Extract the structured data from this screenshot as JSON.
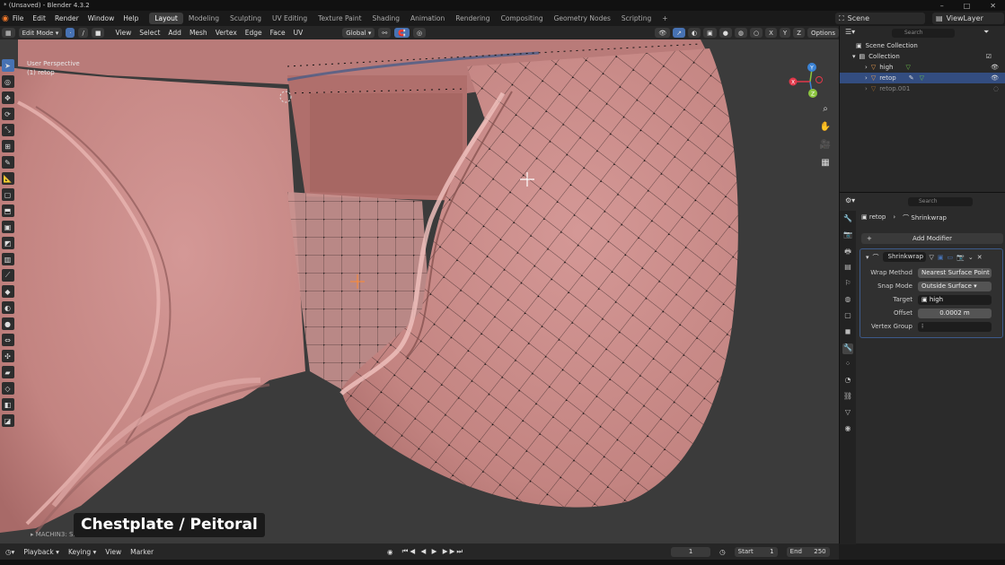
{
  "window": {
    "title": "* (Unsaved) - Blender 4.3.2",
    "controls": [
      "–",
      "□",
      "✕"
    ]
  },
  "menu": [
    "File",
    "Edit",
    "Render",
    "Window",
    "Help"
  ],
  "workspaces": [
    "Layout",
    "Modeling",
    "Sculpting",
    "UV Editing",
    "Texture Paint",
    "Shading",
    "Animation",
    "Rendering",
    "Compositing",
    "Geometry Nodes",
    "Scripting",
    "+"
  ],
  "scene": "Scene",
  "view_layer": "ViewLayer",
  "viewport_header": {
    "mode": "Edit Mode",
    "menus": [
      "View",
      "Select",
      "Add",
      "Mesh",
      "Vertex",
      "Edge",
      "Face",
      "UV"
    ],
    "orientation": "Global",
    "axes": [
      "X",
      "Y",
      "Z"
    ],
    "options": "Options"
  },
  "viewport": {
    "perspective": "User Perspective",
    "object": "(1) retop"
  },
  "gizmo": {
    "x": "X",
    "y": "Y",
    "z": "Z"
  },
  "caption": "Chestplate / Peitoral",
  "operator": "MACHIN3: Smart Vert",
  "timeline": {
    "menus": [
      "Playback",
      "Keying",
      "View",
      "Marker"
    ],
    "current_frame": "1",
    "start_label": "Start",
    "start": "1",
    "end_label": "End",
    "end": "250"
  },
  "outliner": {
    "search_placeholder": "Search",
    "root": "Scene Collection",
    "collection": "Collection",
    "objects": [
      {
        "name": "high",
        "selected": false
      },
      {
        "name": "retop",
        "selected": true
      },
      {
        "name": "retop.001",
        "selected": false
      }
    ]
  },
  "properties": {
    "search_placeholder": "Search",
    "breadcrumb": {
      "object": "retop",
      "modifier": "Shrinkwrap"
    },
    "add_modifier": "Add Modifier",
    "modifier": {
      "name": "Shrinkwrap",
      "wrap_method_label": "Wrap Method",
      "wrap_method": "Nearest Surface Point",
      "snap_mode_label": "Snap Mode",
      "snap_mode": "Outside Surface",
      "target_label": "Target",
      "target": "high",
      "offset_label": "Offset",
      "offset": "0.0002 m",
      "vertex_group_label": "Vertex Group",
      "vertex_group": ""
    }
  },
  "colors": {
    "accent": "#4772b3",
    "skin": "#c98a88",
    "selected_row": "#334d80",
    "wire": "#111111"
  }
}
